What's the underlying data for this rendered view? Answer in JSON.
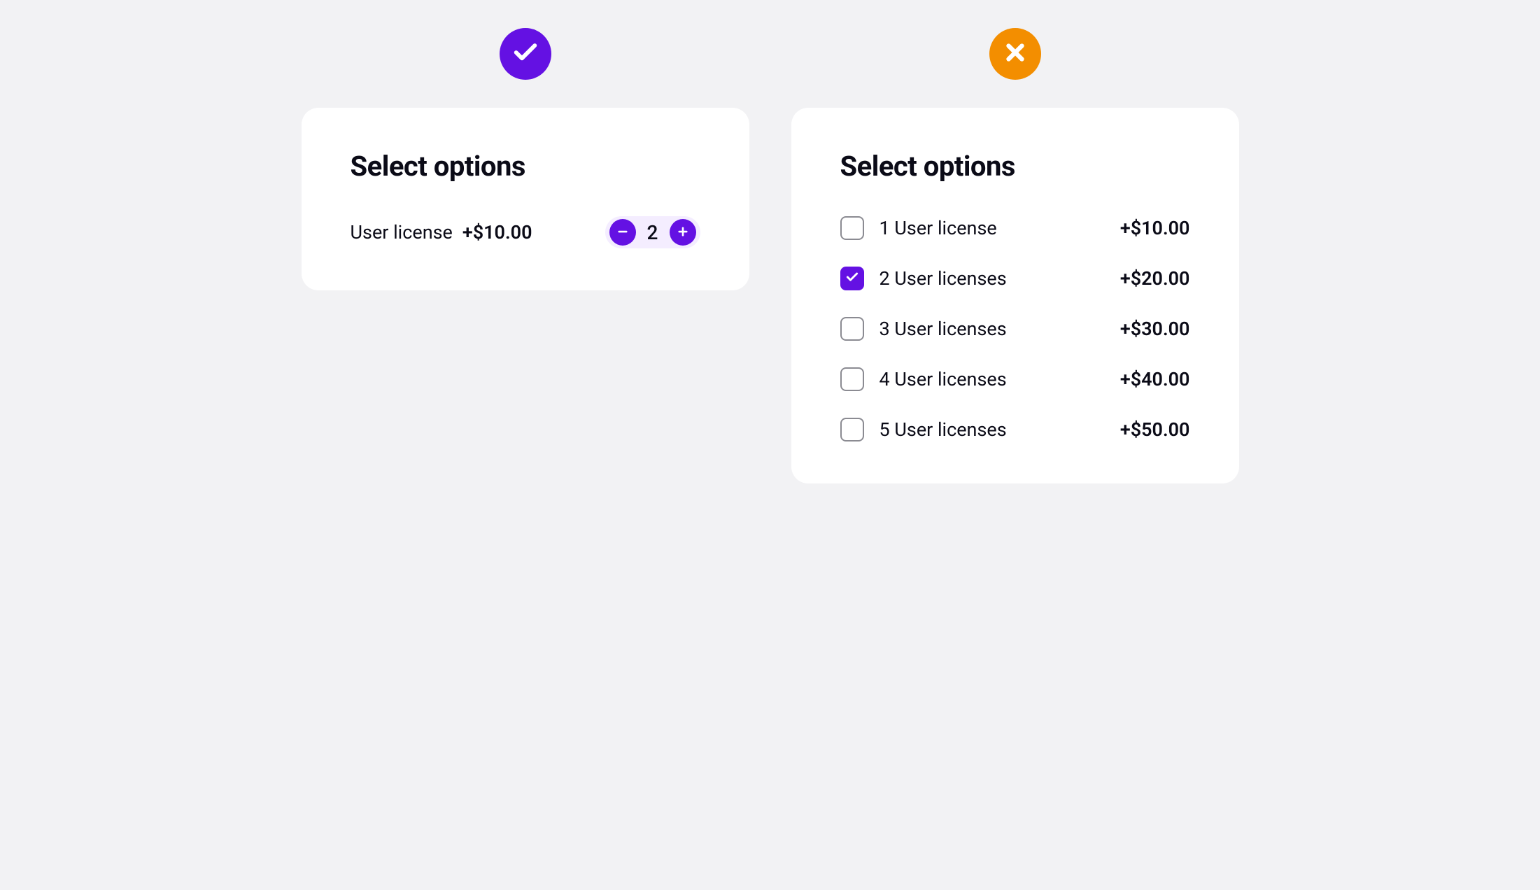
{
  "good": {
    "title": "Select options",
    "item_label": "User license",
    "item_price": "+$10.00",
    "stepper_value": "2"
  },
  "bad": {
    "title": "Select options",
    "options": [
      {
        "label": "1 User license",
        "price": "+$10.00",
        "checked": false
      },
      {
        "label": "2 User licenses",
        "price": "+$20.00",
        "checked": true
      },
      {
        "label": "3 User licenses",
        "price": "+$30.00",
        "checked": false
      },
      {
        "label": "4 User licenses",
        "price": "+$40.00",
        "checked": false
      },
      {
        "label": "5 User licenses",
        "price": "+$50.00",
        "checked": false
      }
    ]
  }
}
